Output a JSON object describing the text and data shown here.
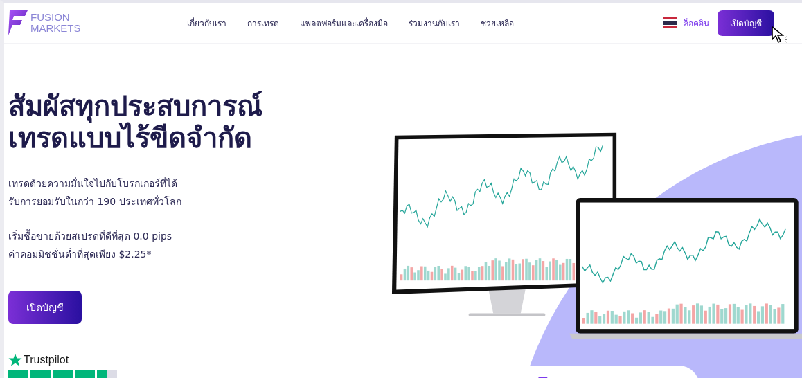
{
  "header": {
    "logo": {
      "line1": "FUSION",
      "line2": "MARKETS"
    },
    "nav": [
      {
        "label": "เกี่ยวกับเรา"
      },
      {
        "label": "การเทรด"
      },
      {
        "label": "แพลตฟอร์มและเครื่องมือ"
      },
      {
        "label": "ร่วมงานกับเรา"
      },
      {
        "label": "ช่วยเหลือ"
      }
    ],
    "login": "ล็อคอิน",
    "open_account": "เปิดบัญชี"
  },
  "hero": {
    "title_lines": [
      "สัมผัสทุกประสบการณ์",
      "เทรดแบบไร้ขีดจำกัด"
    ],
    "paragraphs": [
      [
        "เทรดด้วยความมั่นใจไปกับโบรกเกอร์ที่ได้",
        "รับการยอมรับในกว่า 190 ประเทศทั่วโลก"
      ],
      [
        "เริ่มซื้อขายด้วยสเปรดที่ดีที่สุด 0.0 pips",
        "ค่าคอมมิชชั่นต่ำที่สุดเพียง $2.25*"
      ]
    ],
    "cta": "เปิดบัญชี",
    "trustpilot": {
      "label": "Trustpilot",
      "stars": 4.5
    }
  }
}
